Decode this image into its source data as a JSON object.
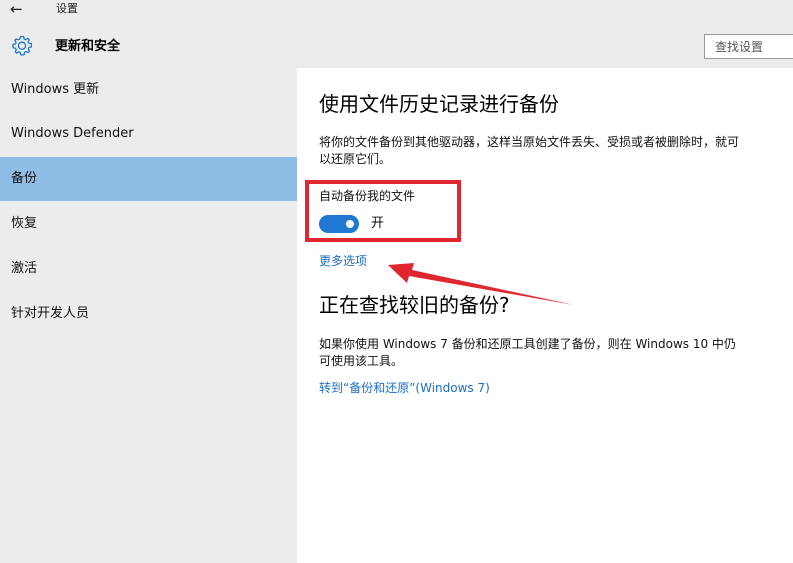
{
  "window": {
    "back_glyph": "←",
    "app_title": "设置"
  },
  "header": {
    "icon": "gear-icon",
    "title": "更新和安全",
    "search_placeholder": "查找设置"
  },
  "sidebar": {
    "items": [
      {
        "label": "Windows 更新",
        "active": false
      },
      {
        "label": "Windows Defender",
        "active": false
      },
      {
        "label": "备份",
        "active": true
      },
      {
        "label": "恢复",
        "active": false
      },
      {
        "label": "激活",
        "active": false
      },
      {
        "label": "针对开发人员",
        "active": false
      }
    ]
  },
  "main": {
    "section1": {
      "title": "使用文件历史记录进行备份",
      "description": "将你的文件备份到其他驱动器，这样当原始文件丢失、受损或者被删除时，就可以还原它们。",
      "toggle_label": "自动备份我的文件",
      "toggle_state": "开",
      "toggle_on": true,
      "more_options": "更多选项"
    },
    "section2": {
      "title": "正在查找较旧的备份?",
      "description": "如果你使用 Windows 7 备份和还原工具创建了备份，则在 Windows 10 中仍可使用该工具。",
      "link": "转到“备份和还原”(Windows 7)"
    }
  },
  "colors": {
    "accent": "#1f78d1",
    "link": "#1a6fc4",
    "sidebar_active": "#8fbde6",
    "annotation_red": "#e0262e",
    "chrome_bg": "#ececec"
  }
}
